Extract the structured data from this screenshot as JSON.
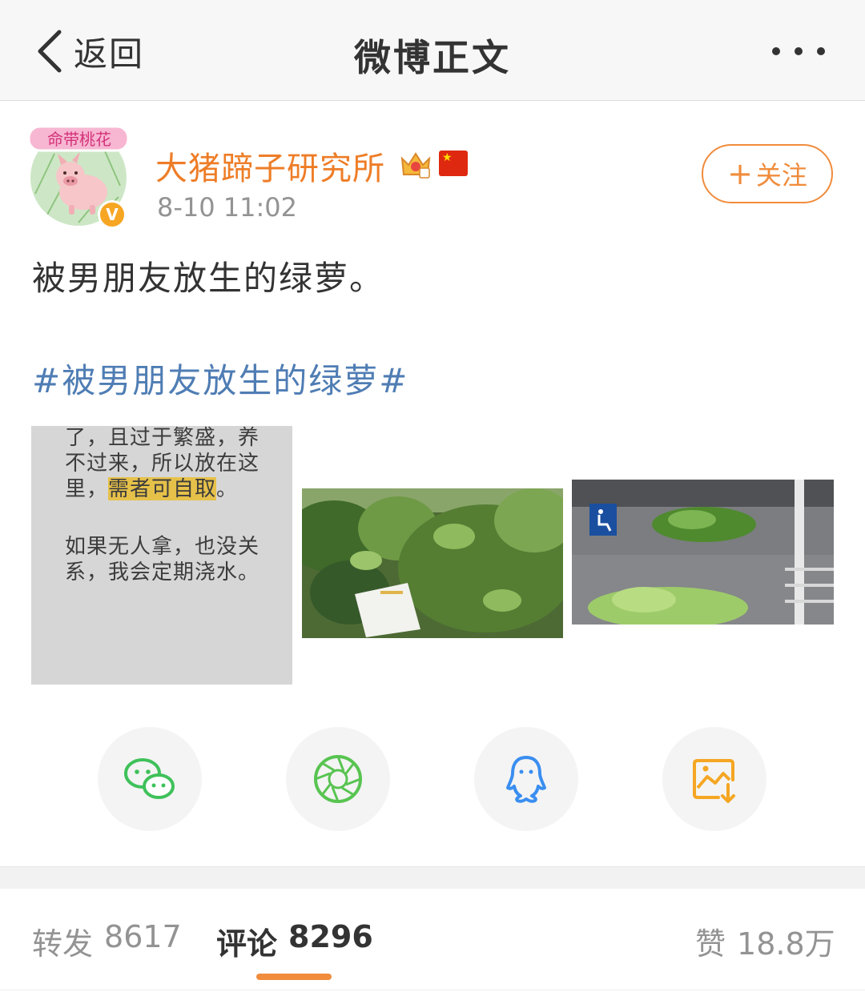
{
  "nav": {
    "back_label": "返回",
    "title": "微博正文"
  },
  "user": {
    "name": "大猪蹄子研究所",
    "avatar_text": "命带桃花",
    "badge": "V",
    "timestamp": "8-10 11:02",
    "follow_label": "关注",
    "follow_symbol": "+"
  },
  "post": {
    "text": "被男朋友放生的绿萝。",
    "topic": "#被男朋友放生的绿萝#"
  },
  "images": [
    {
      "lines": [
        "了，且过于繁盛，养",
        "不过来，所以放在这"
      ],
      "line3_prefix": "里，",
      "line3_highlight": "需者可自取",
      "line3_suffix": "。",
      "lines2": [
        "如果无人拿，也没关",
        "系，我会定期浇水。"
      ]
    },
    {},
    {}
  ],
  "share": {
    "wechat_icon": "wechat-icon",
    "moments_icon": "moments-icon",
    "qq_icon": "qq-icon",
    "save_image_icon": "save-image-icon"
  },
  "tabs": {
    "repost_label": "转发",
    "repost_count": "8617",
    "comment_label": "评论",
    "comment_count": "8296",
    "like_label": "赞",
    "like_count": "18.8万"
  },
  "colors": {
    "accent": "#f08c3c",
    "username": "#ee7d27",
    "topic": "#4f7db4",
    "wechat": "#3fc15a",
    "moments": "#58c451",
    "qq": "#3a8ef0",
    "save": "#f5a623"
  }
}
